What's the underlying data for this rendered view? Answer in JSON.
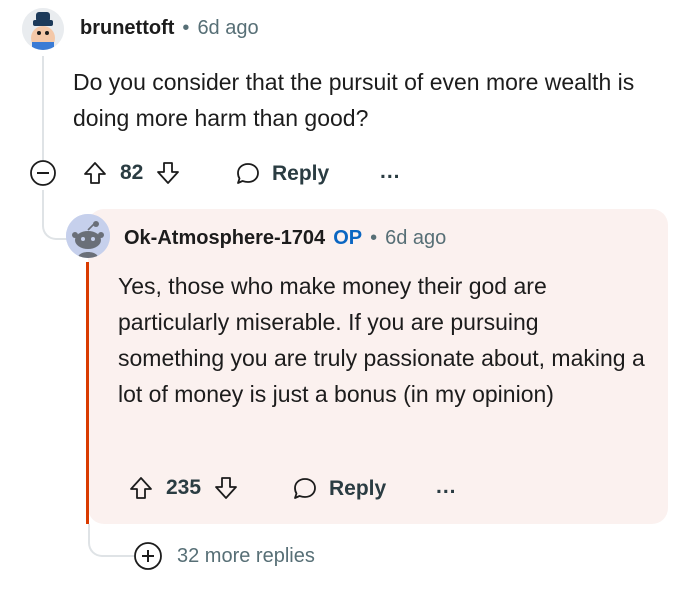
{
  "comment": {
    "username": "brunettoft",
    "separator": "•",
    "time": "6d ago",
    "text": "Do you consider that the pursuit of even more wealth is doing more harm than good?",
    "upvotes": "82",
    "reply_label": "Reply",
    "more_label": "..."
  },
  "reply": {
    "username": "Ok-Atmosphere-1704",
    "op_badge": "OP",
    "separator": "•",
    "time": "6d ago",
    "text": "Yes, those who make money their god are particularly miserable. If you are pursuing something you are truly passionate about, making a lot of money is just a bonus (in my opinion)",
    "upvotes": "235",
    "reply_label": "Reply",
    "more_label": "..."
  },
  "more_replies": "32 more replies",
  "colors": {
    "op_accent": "#d93a00",
    "op_badge": "#0a66c2",
    "reply_bg": "#fbf1ef"
  }
}
